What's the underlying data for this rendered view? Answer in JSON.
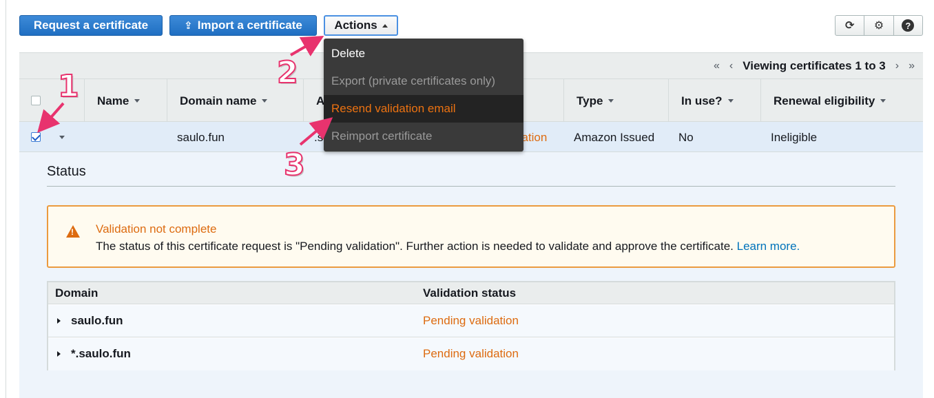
{
  "toolbar": {
    "request_label": "Request a certificate",
    "import_label": "Import a certificate",
    "actions_label": "Actions",
    "icons": [
      "refresh-icon",
      "gear-icon",
      "help-icon"
    ]
  },
  "pager": {
    "first": "«",
    "prev": "‹",
    "text": "Viewing certificates 1 to 3",
    "next": "›",
    "last": "»"
  },
  "table": {
    "headers": {
      "name": "Name",
      "domain": "Domain name",
      "additional": "Ac",
      "type": "Type",
      "in_use": "In use?",
      "renewal": "Renewal eligibility"
    },
    "row": {
      "domain": "saulo.fun",
      "additional": ".s",
      "status": "dation",
      "type": "Amazon Issued",
      "in_use": "No",
      "renewal": "Ineligible"
    }
  },
  "detail": {
    "status_title": "Status",
    "alert_title": "Validation not complete",
    "alert_text": "The status of this certificate request is \"Pending validation\". Further action is needed to validate and approve the certificate.",
    "alert_link": "Learn more.",
    "validation_table": {
      "headers": {
        "domain": "Domain",
        "status": "Validation status"
      },
      "rows": [
        {
          "domain": "saulo.fun",
          "status": "Pending validation"
        },
        {
          "domain": "*.saulo.fun",
          "status": "Pending validation"
        }
      ]
    }
  },
  "actions_menu": {
    "items": [
      {
        "label": "Delete",
        "state": "enabled"
      },
      {
        "label": "Export (private certificates only)",
        "state": "disabled"
      },
      {
        "label": "Resend validation email",
        "state": "highlighted"
      },
      {
        "label": "Reimport certificate",
        "state": "disabled"
      }
    ]
  },
  "annotations": {
    "step1": "1",
    "step2": "2",
    "step3": "3"
  },
  "colors": {
    "primary_button": "#1f6fc2",
    "warning": "#dd6b10",
    "annotation": "#e8336e",
    "link": "#0073bb"
  }
}
